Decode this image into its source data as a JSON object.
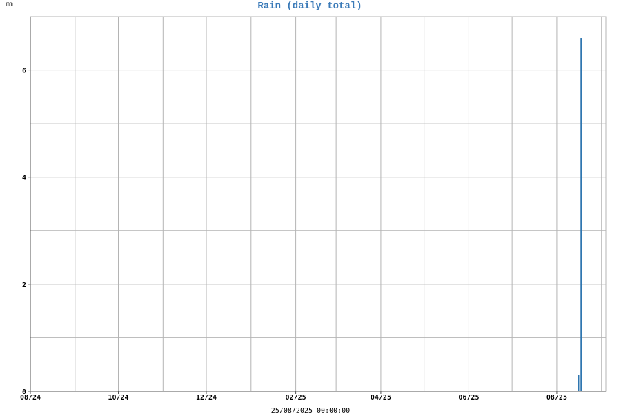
{
  "chart_data": {
    "type": "bar",
    "title": "Rain (daily total)",
    "unit_label": "mm",
    "footer_timestamp": "25/08/2025 00:00:00",
    "x_tick_labels": [
      "08/24",
      "10/24",
      "12/24",
      "02/25",
      "04/25",
      "06/25",
      "08/25"
    ],
    "x_tick_dates": [
      "2024-08-01",
      "2024-10-01",
      "2024-12-01",
      "2025-02-01",
      "2025-04-01",
      "2025-06-01",
      "2025-08-01"
    ],
    "xlim": [
      "2024-08-01",
      "2025-09-04"
    ],
    "y_tick_labels": [
      "0",
      "2",
      "4",
      "6"
    ],
    "ylim": [
      0,
      7
    ],
    "grid": true,
    "series": [
      {
        "x": [
          "2025-08-16",
          "2025-08-18"
        ],
        "values": [
          0.3,
          6.6
        ]
      }
    ]
  },
  "colors": {
    "bar": "#2f76b0",
    "title": "#3a7ab8",
    "grid": "#b4b4b4",
    "axis": "#555555"
  }
}
